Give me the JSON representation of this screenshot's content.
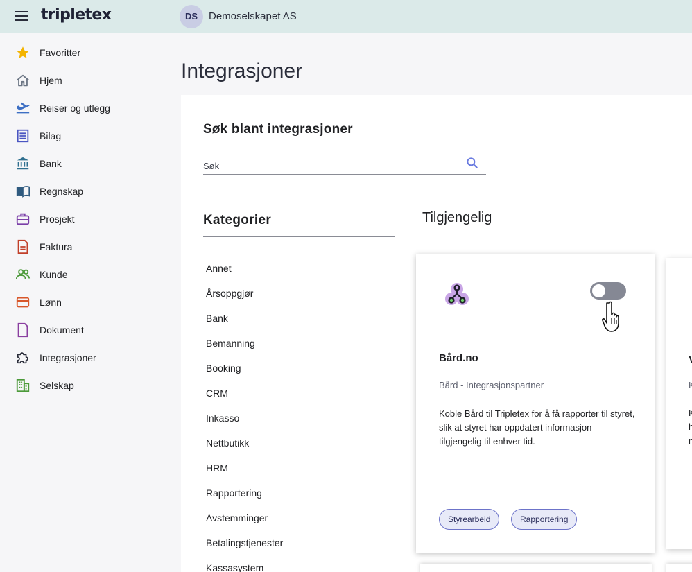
{
  "topbar": {
    "logo": "tripletex",
    "company_initials": "DS",
    "company_name": "Demoselskapet AS"
  },
  "sidebar": {
    "items": [
      {
        "label": "Favoritter",
        "icon": "star-icon"
      },
      {
        "label": "Hjem",
        "icon": "home-icon"
      },
      {
        "label": "Reiser og utlegg",
        "icon": "plane-icon"
      },
      {
        "label": "Bilag",
        "icon": "receipt-icon"
      },
      {
        "label": "Bank",
        "icon": "bank-icon"
      },
      {
        "label": "Regnskap",
        "icon": "book-icon"
      },
      {
        "label": "Prosjekt",
        "icon": "briefcase-icon"
      },
      {
        "label": "Faktura",
        "icon": "invoice-icon"
      },
      {
        "label": "Kunde",
        "icon": "people-icon"
      },
      {
        "label": "Lønn",
        "icon": "wallet-icon"
      },
      {
        "label": "Dokument",
        "icon": "document-icon"
      },
      {
        "label": "Integrasjoner",
        "icon": "puzzle-icon"
      },
      {
        "label": "Selskap",
        "icon": "building-icon"
      }
    ]
  },
  "main": {
    "title": "Integrasjoner",
    "search": {
      "title": "Søk blant integrasjoner",
      "placeholder": "Søk"
    },
    "categories": {
      "title": "Kategorier",
      "items": [
        "Annet",
        "Årsoppgjør",
        "Bank",
        "Bemanning",
        "Booking",
        "CRM",
        "Inkasso",
        "Nettbutikk",
        "HRM",
        "Rapportering",
        "Avstemminger",
        "Betalingstjenester",
        "Kassasystem"
      ]
    },
    "available": {
      "title": "Tilgjengelig",
      "cards": [
        {
          "title": "Bård.no",
          "subtitle": "Bård - Integrasjonspartner",
          "description": "Koble Bård til Tripletex for å få rapporter til styret, slik at styret har oppdatert informasjon tilgjengelig til enhver tid.",
          "enabled": false,
          "tags": [
            "Styrearbeid",
            "Rapportering"
          ]
        }
      ],
      "partial_card": {
        "title_fragment": "V",
        "subtitle_fragment": "K",
        "desc_fragments": [
          "K",
          "h",
          "n"
        ]
      }
    }
  },
  "colors": {
    "topbar_bg": "#dbeae9",
    "sidebar_bg": "#f6f6f8",
    "accent": "#4a55c2",
    "toggle_off": "#858894"
  }
}
